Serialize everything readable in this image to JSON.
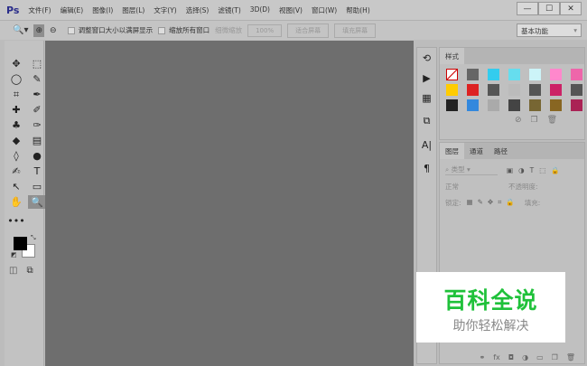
{
  "app": {
    "logo": "Ps"
  },
  "menu": [
    "文件(F)",
    "编辑(E)",
    "图像(I)",
    "图层(L)",
    "文字(Y)",
    "选择(S)",
    "滤镜(T)",
    "3D(D)",
    "视图(V)",
    "窗口(W)",
    "帮助(H)"
  ],
  "window_buttons": [
    "—",
    "☐",
    "✕"
  ],
  "options": {
    "resize_windows": "调整窗口大小以满屏显示",
    "zoom_all": "缩放所有窗口",
    "scrubby": "细微缩放",
    "pct": "100%",
    "fit": "适合屏幕",
    "fill": "填充屏幕",
    "workspace": "基本功能"
  },
  "tools": [
    "✥",
    "⬚",
    "◯",
    "✎",
    "⌗",
    "✒",
    "✚",
    "✐",
    "♣",
    "✑",
    "◆",
    "▤",
    "◊",
    "●",
    "✍",
    "T",
    "↖",
    "▭",
    "✋",
    "🔍"
  ],
  "styles_panel": {
    "tab": "样式",
    "swatches": [
      "#ffffff",
      "#666666",
      "#33ccee",
      "#66ddee",
      "#ccf4f8",
      "#ff88cc",
      "#ee66aa",
      "#ffcc00",
      "#dd2222",
      "#555555",
      "#bbbbbb",
      "#555555",
      "#cc2266",
      "#555555",
      "#222222",
      "#3388dd",
      "#aaaaaa",
      "#444444",
      "#776633",
      "#886622",
      "#aa2255"
    ]
  },
  "layers_panel": {
    "tabs": [
      "图层",
      "通道",
      "路径"
    ],
    "filter": "类型",
    "blend": "正常",
    "opacity": "不透明度:",
    "lock": "锁定:",
    "fill": "填充:",
    "footer_icons": [
      "⚭",
      "fx",
      "◘",
      "◑",
      "▭",
      "❐",
      "🗑"
    ]
  },
  "watermark": {
    "title": "百科全说",
    "subtitle": "助你轻松解决"
  },
  "colors": {
    "canvas": "#6e6e6e",
    "watermark_green": "#1fc13a"
  }
}
